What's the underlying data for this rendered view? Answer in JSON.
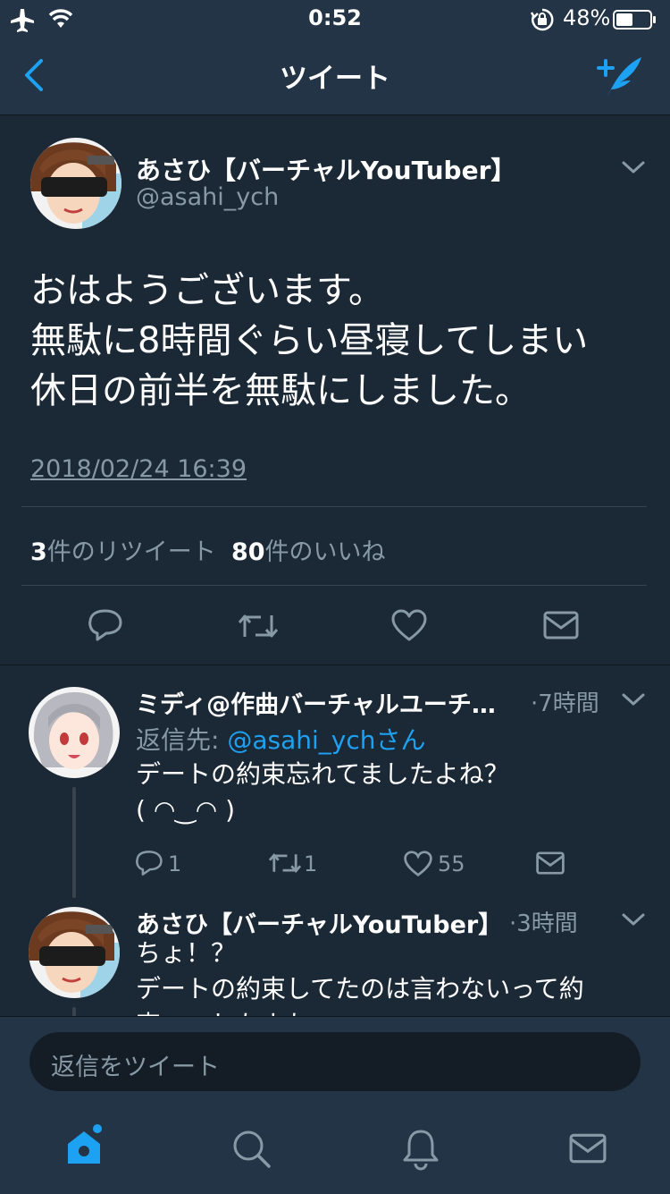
{
  "status_bar": {
    "time": "0:52",
    "battery_percent": "48%"
  },
  "nav": {
    "title": "ツイート"
  },
  "main_tweet": {
    "display_name": "あさひ【バーチャルYouTuber】",
    "handle": "@asahi_ych",
    "text_lines": [
      "おはようございます。",
      "無駄に8時間ぐらい昼寝してしまい",
      "休日の前半を無駄にしました。"
    ],
    "timestamp": "2018/02/24 16:39",
    "retweet_count": "3",
    "retweet_label": "件のリツイート",
    "like_count": "80",
    "like_label": "件のいいね"
  },
  "replies": [
    {
      "display_name": "ミディ@作曲バーチャルユーチ…",
      "time": "·7時間",
      "reply_to_label": "返信先: ",
      "reply_to_handle": "@asahi_ychさん",
      "text_lines": [
        "デートの約束忘れてましたよね？",
        "( ◠‿◠ )"
      ],
      "reply_count": "1",
      "retweet_count": "1",
      "like_count": "55"
    },
    {
      "display_name": "あさひ【バーチャルYouTuber】",
      "time": "·3時間",
      "text_lines": [
        "ちょ！？",
        "デートの約束してたのは言わないって約",
        "束……したよね"
      ]
    }
  ],
  "composer": {
    "placeholder": "返信をツイート"
  },
  "colors": {
    "accent": "#1da1f2",
    "background": "#141d26",
    "card": "#1b2836",
    "bar": "#243447",
    "muted": "#8899a6"
  }
}
